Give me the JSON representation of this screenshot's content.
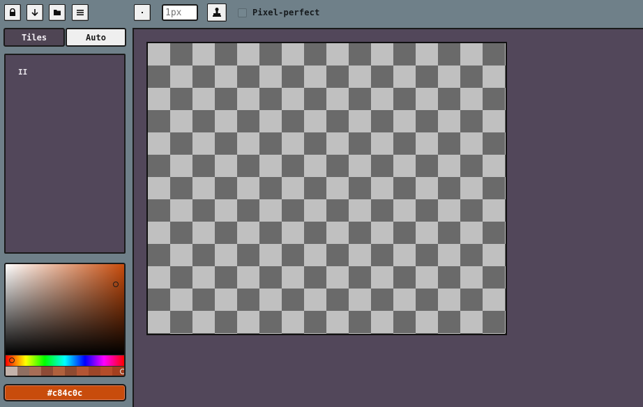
{
  "toolbar": {
    "buttons": [
      {
        "name": "lock-button",
        "icon": "lock-icon"
      },
      {
        "name": "download-button",
        "icon": "arrow-down-icon"
      },
      {
        "name": "folder-button",
        "icon": "folder-icon"
      },
      {
        "name": "menu-button",
        "icon": "hamburger-menu-icon"
      }
    ],
    "brush_shape_icon": "dot-icon",
    "brush_size_value": "",
    "brush_size_placeholder": "1px",
    "tool_icon": "ink-stamp-icon",
    "pixel_perfect": {
      "label": "Pixel-perfect",
      "checked": false
    }
  },
  "sidebar": {
    "tabs": [
      {
        "label": "Tiles",
        "active": true
      },
      {
        "label": "Auto",
        "active": false
      }
    ],
    "tiles_panel": {
      "items": [
        "II"
      ]
    },
    "color_picker": {
      "current_hex": "#c84c0c",
      "base_hue_color": "#c84c0c",
      "swatches": [
        "#c4b3ab",
        "#8f6f62",
        "#a86d56",
        "#8e4b36",
        "#b0613d",
        "#8e4a30",
        "#b35534",
        "#9d4628",
        "#b54d2a",
        "#a43f1f"
      ]
    },
    "hex_label": "#c84c0c"
  },
  "canvas": {
    "background": "transparent-checkerboard",
    "checker_light": "#c0c0c0",
    "checker_dark": "#6a6a6a"
  },
  "colors": {
    "window_bg": "#6f8089",
    "panel_bg": "#52475a",
    "accent": "#c84c0c"
  }
}
